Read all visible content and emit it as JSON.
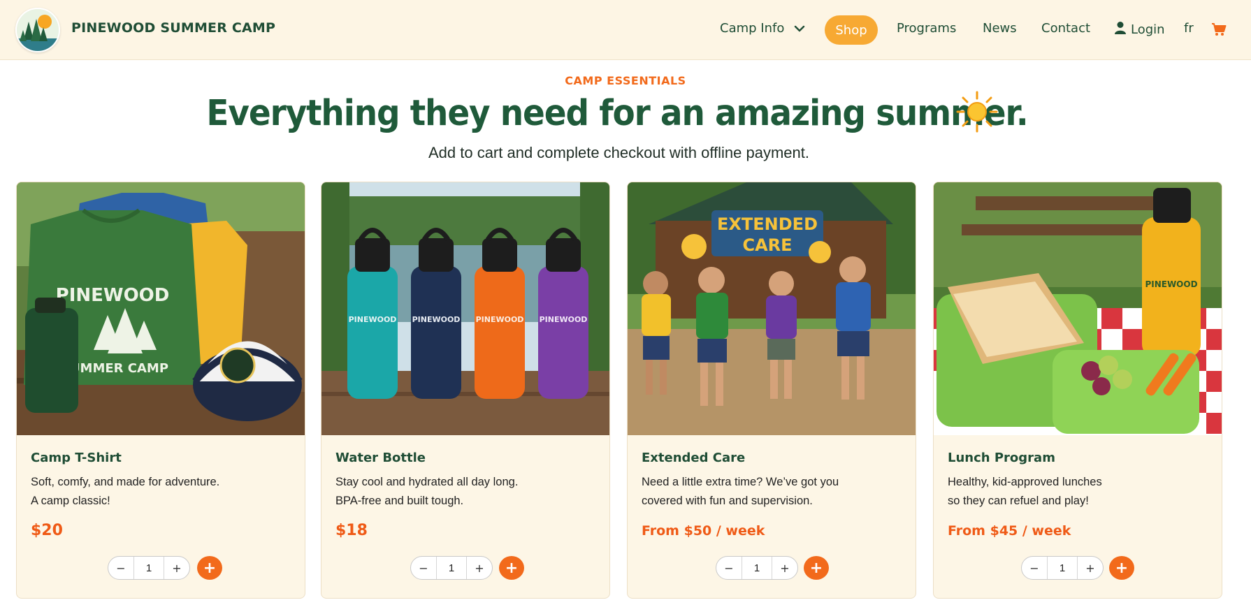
{
  "header": {
    "brand": "PINEWOOD SUMMER CAMP",
    "nav": {
      "camp_info": "Camp Info",
      "shop": "Shop",
      "programs": "Programs",
      "news": "News",
      "contact": "Contact",
      "login": "Login",
      "language": "fr"
    },
    "icons": {
      "dropdown": "chevron-down-icon",
      "user": "user-icon",
      "cart": "cart-icon"
    }
  },
  "hero": {
    "eyebrow": "CAMP ESSENTIALS",
    "headline": "Everything they need for an amazing summer.",
    "subhead": "Add to cart and complete checkout with offline payment."
  },
  "products": [
    {
      "title": "Camp T-Shirt",
      "desc_line1": "Soft, comfy, and made for adventure.",
      "desc_line2": "A camp classic!",
      "price": "$20",
      "qty": "1"
    },
    {
      "title": "Water Bottle",
      "desc_line1": "Stay cool and hydrated all day long.",
      "desc_line2": "BPA-free and built tough.",
      "price": "$18",
      "qty": "1"
    },
    {
      "title": "Extended Care",
      "desc_line1": "Need a little extra time? We’ve got you",
      "desc_line2": "covered with fun and supervision.",
      "price": "From $50 / week",
      "qty": "1",
      "image_sign_line1": "EXTENDED",
      "image_sign_line2": "CARE"
    },
    {
      "title": "Lunch Program",
      "desc_line1": "Healthy, kid-approved lunches",
      "desc_line2": "so they can refuel and play!",
      "price": "From $45 / week",
      "qty": "1"
    }
  ],
  "product_print": {
    "line1": "PINEWOOD",
    "line2": "SUMMER CAMP"
  },
  "controls": {
    "minus": "−",
    "plus": "+",
    "add": "+"
  },
  "colors": {
    "brand_green": "#1f4d35",
    "accent_orange": "#f26a1b",
    "shop_pill": "#f7a933",
    "header_bg": "#fdf5e4",
    "card_bg": "#fdf6e6"
  }
}
